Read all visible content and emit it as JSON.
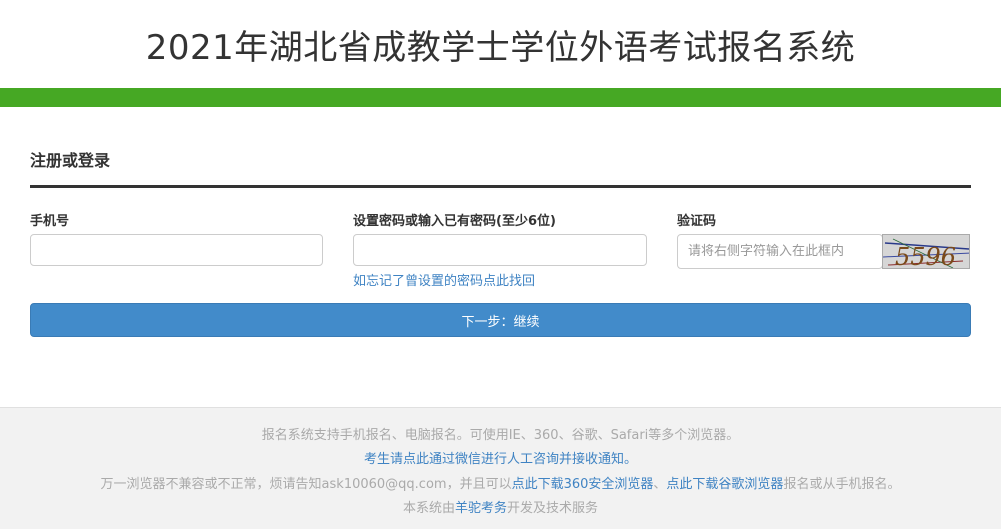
{
  "header": {
    "title": "2021年湖北省成教学士学位外语考试报名系统"
  },
  "form": {
    "section_title": "注册或登录",
    "phone_label": "手机号",
    "password_label": "设置密码或输入已有密码(至少6位)",
    "captcha_label": "验证码",
    "captcha_placeholder": "请将右侧字符输入在此框内",
    "captcha_text": "5596",
    "forgot_link": "如忘记了曾设置的密码点此找回",
    "next_button": "下一步：继续"
  },
  "footer": {
    "line1": "报名系统支持手机报名、电脑报名。可使用IE、360、谷歌、Safari等多个浏览器。",
    "line2_link": "考生请点此通过微信进行人工咨询并接收通知。",
    "line3_pre": "万一浏览器不兼容或不正常，烦请告知ask10060@qq.com，并且可以",
    "line3_link1": "点此下载360安全浏览器",
    "line3_sep": "、",
    "line3_link2": "点此下载谷歌浏览器",
    "line3_post": "报名或从手机报名。",
    "line4_pre": "本系统由",
    "line4_link": "羊驼考务",
    "line4_post": "开发及技术服务"
  },
  "colors": {
    "accent_green": "#46a824",
    "primary_blue": "#428bca",
    "link_blue": "#3f83c3"
  }
}
